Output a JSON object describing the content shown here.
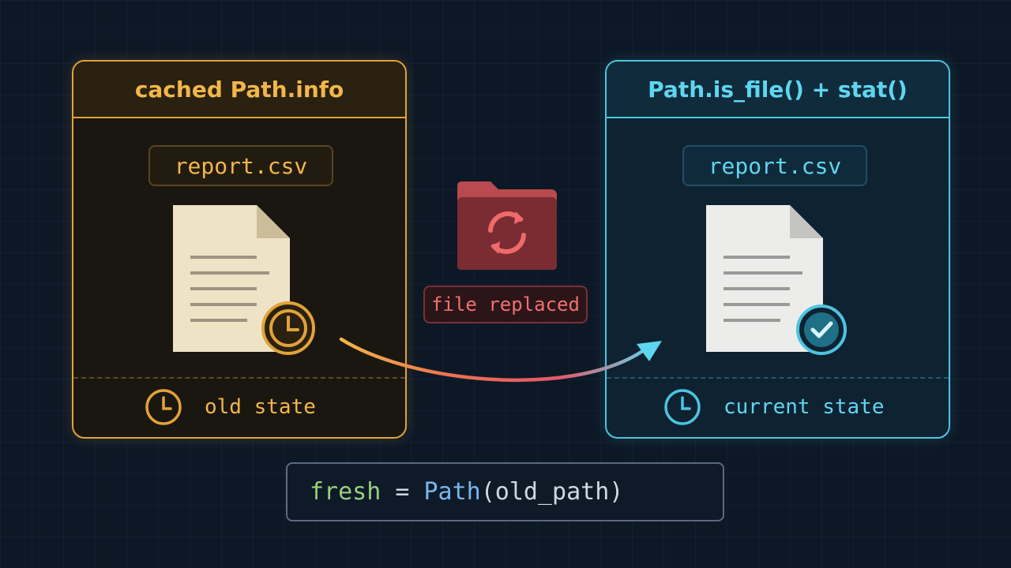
{
  "left_panel": {
    "title": "cached Path.info",
    "filename": "report.csv",
    "state_label": "old state"
  },
  "right_panel": {
    "title": "Path.is_file() + stat()",
    "filename": "report.csv",
    "state_label": "current state"
  },
  "middle": {
    "replaced_label": "file replaced"
  },
  "code": {
    "var": "fresh",
    "op": " = ",
    "cls": "Path",
    "rest": "(old_path)"
  },
  "colors": {
    "old_accent": "#e2a23a",
    "current_accent": "#4cc4e0",
    "replaced_accent": "#e05a5a"
  },
  "icons": [
    "document-icon",
    "clock-icon",
    "check-circle-icon",
    "folder-sync-icon",
    "arrow-icon"
  ]
}
